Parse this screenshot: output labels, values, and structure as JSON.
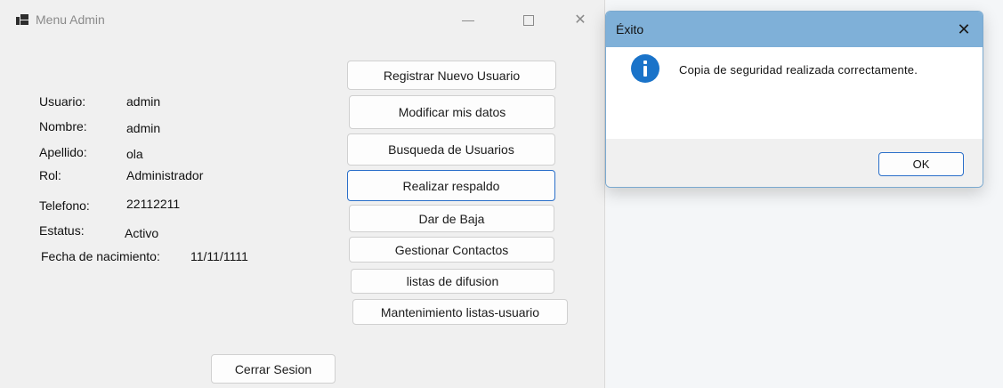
{
  "main_window": {
    "title": "Menu Admin",
    "controls": {
      "minimize": "minimize",
      "maximize": "maximize",
      "close": "✕"
    }
  },
  "user_info": {
    "usuario": {
      "label": "Usuario:",
      "value": "admin"
    },
    "nombre": {
      "label": "Nombre:",
      "value": "admin"
    },
    "apellido": {
      "label": "Apellido:",
      "value": "ola"
    },
    "rol": {
      "label": "Rol:",
      "value": "Administrador"
    },
    "telefono": {
      "label": "Telefono:",
      "value": "22112211"
    },
    "estatus": {
      "label": "Estatus:",
      "value": "Activo"
    },
    "fecha_nacimiento": {
      "label": "Fecha de nacimiento:",
      "value": "11/11/1111"
    }
  },
  "buttons": {
    "registrar": "Registrar Nuevo Usuario",
    "modificar": "Modificar mis datos",
    "busqueda": "Busqueda de Usuarios",
    "respaldo": "Realizar respaldo",
    "baja": "Dar de Baja",
    "contactos": "Gestionar Contactos",
    "difusion": "listas de difusion",
    "mantenimiento": "Mantenimiento listas-usuario",
    "cerrar_sesion": "Cerrar Sesion"
  },
  "dialog": {
    "title": "Éxito",
    "close": "✕",
    "message": "Copia de seguridad realizada correctamente.",
    "ok_label": "OK",
    "icon": "info-icon"
  },
  "colors": {
    "dialog_titlebar": "#7fb0d8",
    "info_icon": "#1a73c9",
    "focus_border": "#2a6fc9"
  }
}
